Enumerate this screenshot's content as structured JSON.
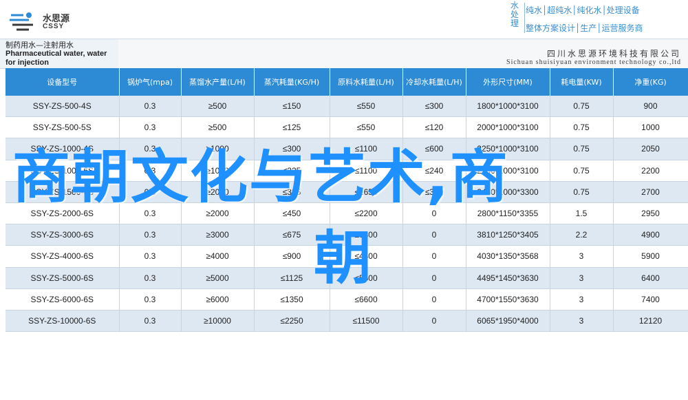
{
  "header": {
    "logo_cn": "水思源",
    "logo_en": "CSSY",
    "brand_vertical": "水处理",
    "brand_line1": "纯水│超纯水│纯化水│处理设备",
    "brand_line2": "整体方案设计│生产│运营服务商"
  },
  "product": {
    "title_cn": "制药用水—注射用水",
    "title_en": "Pharmaceutical water, water for injection"
  },
  "company": {
    "name_cn": "四川水思源环境科技有限公司",
    "name_en": "Sichuan shuisiyuan environment technology co.,ltd"
  },
  "table": {
    "headers": [
      "设备型号",
      "锅炉气(mpa)",
      "蒸馏水产量(L/H)",
      "蒸汽耗量(KG/H)",
      "原料水耗量(L/H)",
      "冷却水耗量(L/H)",
      "外形尺寸(MM)",
      "耗电量(KW)",
      "净重(KG)"
    ],
    "rows": [
      [
        "SSY-ZS-500-4S",
        "0.3",
        "≥500",
        "≤150",
        "≤550",
        "≤300",
        "1800*1000*3100",
        "0.75",
        "900"
      ],
      [
        "SSY-ZS-500-5S",
        "0.3",
        "≥500",
        "≤125",
        "≤550",
        "≤120",
        "2000*1000*3100",
        "0.75",
        "1000"
      ],
      [
        "SSY-ZS-1000-4S",
        "0.3",
        "≥1000",
        "≤300",
        "≤1100",
        "≤600",
        "2250*1000*3100",
        "0.75",
        "2050"
      ],
      [
        "SSY-ZS-1000-6S",
        "0.3",
        "≥1000",
        "≤225",
        "≤1100",
        "≤240",
        "2500*1000*3100",
        "0.75",
        "2200"
      ],
      [
        "SSY-ZS-1500-6S",
        "0.3",
        "≥2000",
        "≤325",
        "≤1650",
        "≤350",
        "2450*1000*3300",
        "0.75",
        "2700"
      ],
      [
        "SSY-ZS-2000-6S",
        "0.3",
        "≥2000",
        "≤450",
        "≤2200",
        "0",
        "2800*1150*3355",
        "1.5",
        "2950"
      ],
      [
        "SSY-ZS-3000-6S",
        "0.3",
        "≥3000",
        "≤675",
        "≤3300",
        "0",
        "3810*1250*3405",
        "2.2",
        "4900"
      ],
      [
        "SSY-ZS-4000-6S",
        "0.3",
        "≥4000",
        "≤900",
        "≤4400",
        "0",
        "4030*1350*3568",
        "3",
        "5900"
      ],
      [
        "SSY-ZS-5000-6S",
        "0.3",
        "≥5000",
        "≤1125",
        "≤5500",
        "0",
        "4495*1450*3630",
        "3",
        "6400"
      ],
      [
        "SSY-ZS-6000-6S",
        "0.3",
        "≥6000",
        "≤1350",
        "≤6600",
        "0",
        "4700*1550*3630",
        "3",
        "7400"
      ],
      [
        "SSY-ZS-10000-6S",
        "0.3",
        "≥10000",
        "≤2250",
        "≤11500",
        "0",
        "6065*1950*4000",
        "3",
        "12120"
      ]
    ]
  },
  "overlay": {
    "line1": "商朝文化与艺术,商",
    "line2": "朝"
  },
  "colors": {
    "header_blue": "#2d8ad4",
    "row_stripe": "#dde8f3",
    "overlay_text": "#1e90ff"
  }
}
